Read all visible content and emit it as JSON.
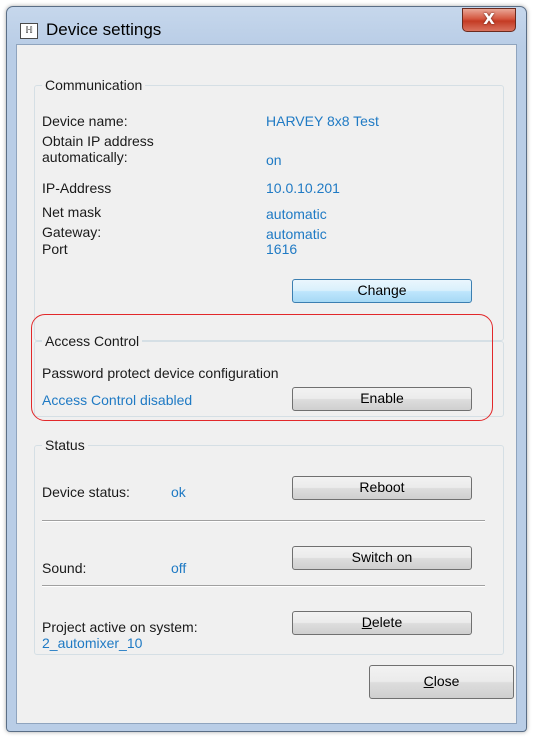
{
  "window": {
    "title": "Device settings",
    "close_glyph": "X"
  },
  "communication": {
    "title": "Communication",
    "device_name_label": "Device name:",
    "device_name_value": "HARVEY 8x8 Test",
    "obtain_ip_label_1": "Obtain IP address",
    "obtain_ip_label_2": "automatically:",
    "obtain_ip_value": "on",
    "ip_label": "IP-Address",
    "ip_value": "10.0.10.201",
    "netmask_label": "Net mask",
    "netmask_value": "automatic",
    "gateway_label": "Gateway:",
    "gateway_value": "automatic",
    "port_label": "Port",
    "port_value": "1616",
    "change_button": "Change"
  },
  "access_control": {
    "title": "Access Control",
    "description": "Password protect device configuration",
    "status": "Access Control disabled",
    "enable_button": "Enable"
  },
  "status": {
    "title": "Status",
    "device_status_label": "Device status:",
    "device_status_value": "ok",
    "reboot_button": "Reboot",
    "sound_label": "Sound:",
    "sound_value": "off",
    "switch_on_button": "Switch on",
    "project_label": "Project active on system:",
    "project_value": "2_automixer_10",
    "delete_button_first": "D",
    "delete_button_rest": "elete"
  },
  "footer": {
    "close_button_first": "C",
    "close_button_rest": "lose"
  },
  "colors": {
    "value_text": "#1f7ac4",
    "highlight": "#e2282a"
  }
}
